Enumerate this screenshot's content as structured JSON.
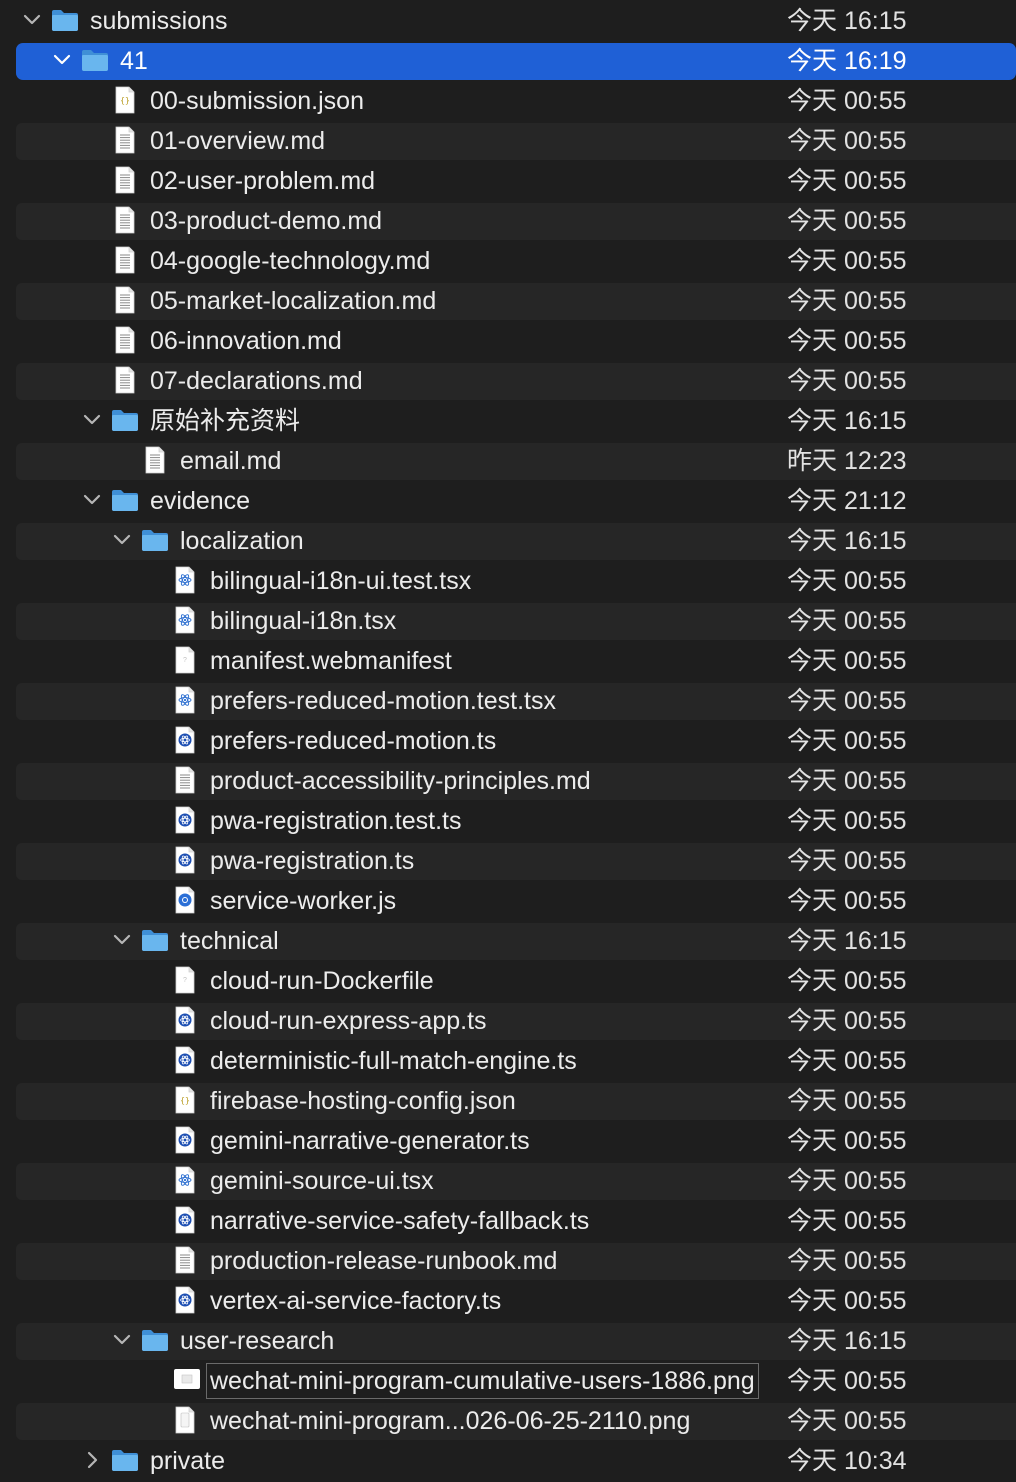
{
  "rows": [
    {
      "name": "submissions",
      "date": "今天 16:15",
      "type": "folder",
      "level": 0,
      "state": "expanded"
    },
    {
      "name": "41",
      "date": "今天 16:19",
      "type": "folder",
      "level": 1,
      "state": "expanded",
      "selected": true
    },
    {
      "name": "00-submission.json",
      "date": "今天 00:55",
      "type": "json",
      "level": 2
    },
    {
      "name": "01-overview.md",
      "date": "今天 00:55",
      "type": "doc",
      "level": 2
    },
    {
      "name": "02-user-problem.md",
      "date": "今天 00:55",
      "type": "doc",
      "level": 2
    },
    {
      "name": "03-product-demo.md",
      "date": "今天 00:55",
      "type": "doc",
      "level": 2
    },
    {
      "name": "04-google-technology.md",
      "date": "今天 00:55",
      "type": "doc",
      "level": 2
    },
    {
      "name": "05-market-localization.md",
      "date": "今天 00:55",
      "type": "doc",
      "level": 2
    },
    {
      "name": "06-innovation.md",
      "date": "今天 00:55",
      "type": "doc",
      "level": 2
    },
    {
      "name": "07-declarations.md",
      "date": "今天 00:55",
      "type": "doc",
      "level": 2
    },
    {
      "name": "原始补充资料",
      "date": "今天 16:15",
      "type": "folder",
      "level": 2,
      "state": "expanded"
    },
    {
      "name": "email.md",
      "date": "昨天 12:23",
      "type": "doc",
      "level": 3
    },
    {
      "name": "evidence",
      "date": "今天 21:12",
      "type": "folder",
      "level": 2,
      "state": "expanded"
    },
    {
      "name": "localization",
      "date": "今天 16:15",
      "type": "folder",
      "level": 3,
      "state": "expanded"
    },
    {
      "name": "bilingual-i18n-ui.test.tsx",
      "date": "今天 00:55",
      "type": "react",
      "level": 4
    },
    {
      "name": "bilingual-i18n.tsx",
      "date": "今天 00:55",
      "type": "react",
      "level": 4
    },
    {
      "name": "manifest.webmanifest",
      "date": "今天 00:55",
      "type": "blank",
      "level": 4
    },
    {
      "name": "prefers-reduced-motion.test.tsx",
      "date": "今天 00:55",
      "type": "react",
      "level": 4
    },
    {
      "name": "prefers-reduced-motion.ts",
      "date": "今天 00:55",
      "type": "ts",
      "level": 4
    },
    {
      "name": "product-accessibility-principles.md",
      "date": "今天 00:55",
      "type": "doc",
      "level": 4
    },
    {
      "name": "pwa-registration.test.ts",
      "date": "今天 00:55",
      "type": "ts",
      "level": 4
    },
    {
      "name": "pwa-registration.ts",
      "date": "今天 00:55",
      "type": "ts",
      "level": 4
    },
    {
      "name": "service-worker.js",
      "date": "今天 00:55",
      "type": "chrome",
      "level": 4
    },
    {
      "name": "technical",
      "date": "今天 16:15",
      "type": "folder",
      "level": 3,
      "state": "expanded"
    },
    {
      "name": "cloud-run-Dockerfile",
      "date": "今天 00:55",
      "type": "blank",
      "level": 4
    },
    {
      "name": "cloud-run-express-app.ts",
      "date": "今天 00:55",
      "type": "ts",
      "level": 4
    },
    {
      "name": "deterministic-full-match-engine.ts",
      "date": "今天 00:55",
      "type": "ts",
      "level": 4
    },
    {
      "name": "firebase-hosting-config.json",
      "date": "今天 00:55",
      "type": "json",
      "level": 4
    },
    {
      "name": "gemini-narrative-generator.ts",
      "date": "今天 00:55",
      "type": "ts",
      "level": 4
    },
    {
      "name": "gemini-source-ui.tsx",
      "date": "今天 00:55",
      "type": "react",
      "level": 4
    },
    {
      "name": "narrative-service-safety-fallback.ts",
      "date": "今天 00:55",
      "type": "ts",
      "level": 4
    },
    {
      "name": "production-release-runbook.md",
      "date": "今天 00:55",
      "type": "doc",
      "level": 4
    },
    {
      "name": "vertex-ai-service-factory.ts",
      "date": "今天 00:55",
      "type": "ts",
      "level": 4
    },
    {
      "name": "user-research",
      "date": "今天 16:15",
      "type": "folder",
      "level": 3,
      "state": "expanded"
    },
    {
      "name": "wechat-mini-program-cumulative-users-1886.png",
      "date": "今天 00:55",
      "type": "image",
      "level": 4,
      "editing": true
    },
    {
      "name": "wechat-mini-program...026-06-25-2110.png",
      "date": "今天 00:55",
      "type": "image2",
      "level": 4
    },
    {
      "name": "private",
      "date": "今天 10:34",
      "type": "folder",
      "level": 2,
      "state": "collapsed"
    }
  ],
  "icons": {
    "folder": "folder-icon",
    "json": "json-file-icon",
    "doc": "text-document-icon",
    "react": "react-file-icon",
    "ts": "typescript-file-icon",
    "blank": "blank-file-icon",
    "chrome": "chrome-file-icon",
    "image": "image-file-icon",
    "image2": "image-file-icon"
  },
  "colors": {
    "selection": "#1f60d6",
    "folder": "#5aa9e6",
    "background": "#1e1e1e",
    "stripe": "#262626"
  }
}
